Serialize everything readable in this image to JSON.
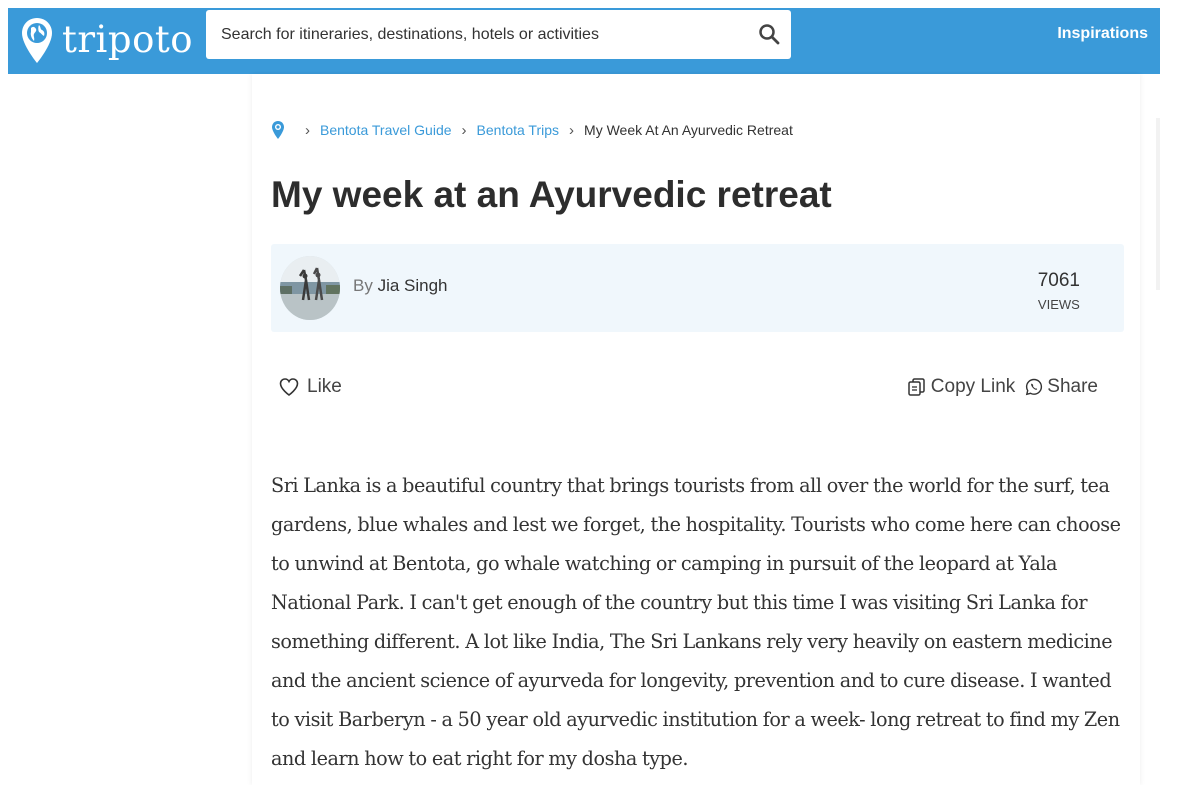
{
  "header": {
    "logo_text": "tripoto",
    "search_placeholder": "Search for itineraries, destinations, hotels or activities",
    "nav_inspirations": "Inspirations",
    "brand_color": "#3a9ad9",
    "icons": {
      "logo": "location-pin-globe-icon",
      "search": "search-icon"
    }
  },
  "breadcrumb": {
    "home_icon": "location-pin-icon",
    "items": [
      {
        "label": "Bentota Travel Guide"
      },
      {
        "label": "Bentota Trips"
      },
      {
        "label": "My Week At An Ayurvedic Retreat"
      }
    ]
  },
  "article": {
    "title": "My week at an Ayurvedic retreat",
    "author_prefix": "By",
    "author_name": "Jia Singh",
    "views_count": "7061",
    "views_label": "VIEWS",
    "body": "Sri Lanka is a beautiful country that brings tourists from all over the world for the surf, tea gardens, blue whales and lest we forget, the hospitality. Tourists who come here can choose to unwind at Bentota, go whale watching or camping in pursuit of the leopard at Yala National Park. I can't get enough of the country but this time I was visiting Sri Lanka for something different. A lot like India, The Sri Lankans rely very heavily on eastern medicine and the ancient science of ayurveda for longevity, prevention and to cure disease. I wanted to visit Barberyn - a 50 year old ayurvedic institution for a week- long retreat to find my Zen and learn how to eat right for my dosha type."
  },
  "actions": {
    "like": "Like",
    "copy_link": "Copy Link",
    "share": "Share",
    "icons": {
      "like": "heart-icon",
      "copy": "copy-icon",
      "share": "whatsapp-icon"
    }
  }
}
